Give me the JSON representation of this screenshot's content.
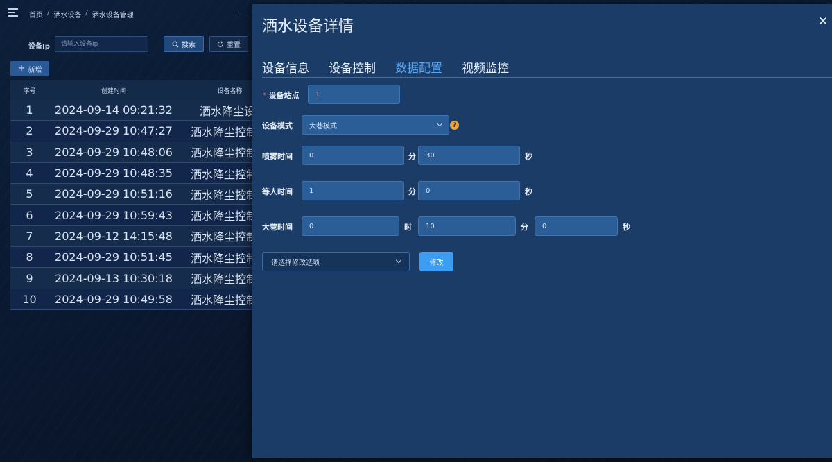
{
  "breadcrumb": [
    "首页",
    "洒水设备",
    "洒水设备管理"
  ],
  "search": {
    "label": "设备Ip",
    "placeholder": "请输入设备Ip",
    "search_btn": "搜索",
    "reset_btn": "重置",
    "add_btn": "新增"
  },
  "table": {
    "headers": {
      "index": "序号",
      "created": "创建时间",
      "name": "设备名称"
    },
    "rows": [
      {
        "index": "1",
        "created": "2024-09-14 09:21:32",
        "name": "洒水降尘设"
      },
      {
        "index": "2",
        "created": "2024-09-29 10:47:27",
        "name": "洒水降尘控制"
      },
      {
        "index": "3",
        "created": "2024-09-29 10:48:06",
        "name": "洒水降尘控制"
      },
      {
        "index": "4",
        "created": "2024-09-29 10:48:35",
        "name": "洒水降尘控制"
      },
      {
        "index": "5",
        "created": "2024-09-29 10:51:16",
        "name": "洒水降尘控制"
      },
      {
        "index": "6",
        "created": "2024-09-29 10:59:43",
        "name": "洒水降尘控制"
      },
      {
        "index": "7",
        "created": "2024-09-12 14:15:48",
        "name": "洒水降尘控制"
      },
      {
        "index": "8",
        "created": "2024-09-29 10:51:45",
        "name": "洒水降尘控制"
      },
      {
        "index": "9",
        "created": "2024-09-13 10:30:18",
        "name": "洒水降尘控制"
      },
      {
        "index": "10",
        "created": "2024-09-29 10:49:58",
        "name": "洒水降尘控制"
      }
    ]
  },
  "drawer": {
    "title": "洒水设备详情",
    "tabs": [
      "设备信息",
      "设备控制",
      "数据配置",
      "视频监控"
    ],
    "active_tab": 2,
    "form": {
      "station": {
        "label": "设备站点",
        "value": "1"
      },
      "mode": {
        "label": "设备模式",
        "value": "大巷模式"
      },
      "spray": {
        "label": "喷雾时间",
        "min": "0",
        "sec": "30"
      },
      "wait": {
        "label": "等人时间",
        "min": "1",
        "sec": "0"
      },
      "alley": {
        "label": "大巷时间",
        "hour": "0",
        "min": "10",
        "sec": "0"
      },
      "units": {
        "hour": "时",
        "min": "分",
        "sec": "秒"
      },
      "option_placeholder": "请选择修改选项",
      "modify_btn": "修改"
    }
  },
  "colors": {
    "accent": "#3c9ef2",
    "active_tab": "#57a6f5",
    "drawer_bg": "#1b3c66",
    "help": "#f0a23a"
  }
}
